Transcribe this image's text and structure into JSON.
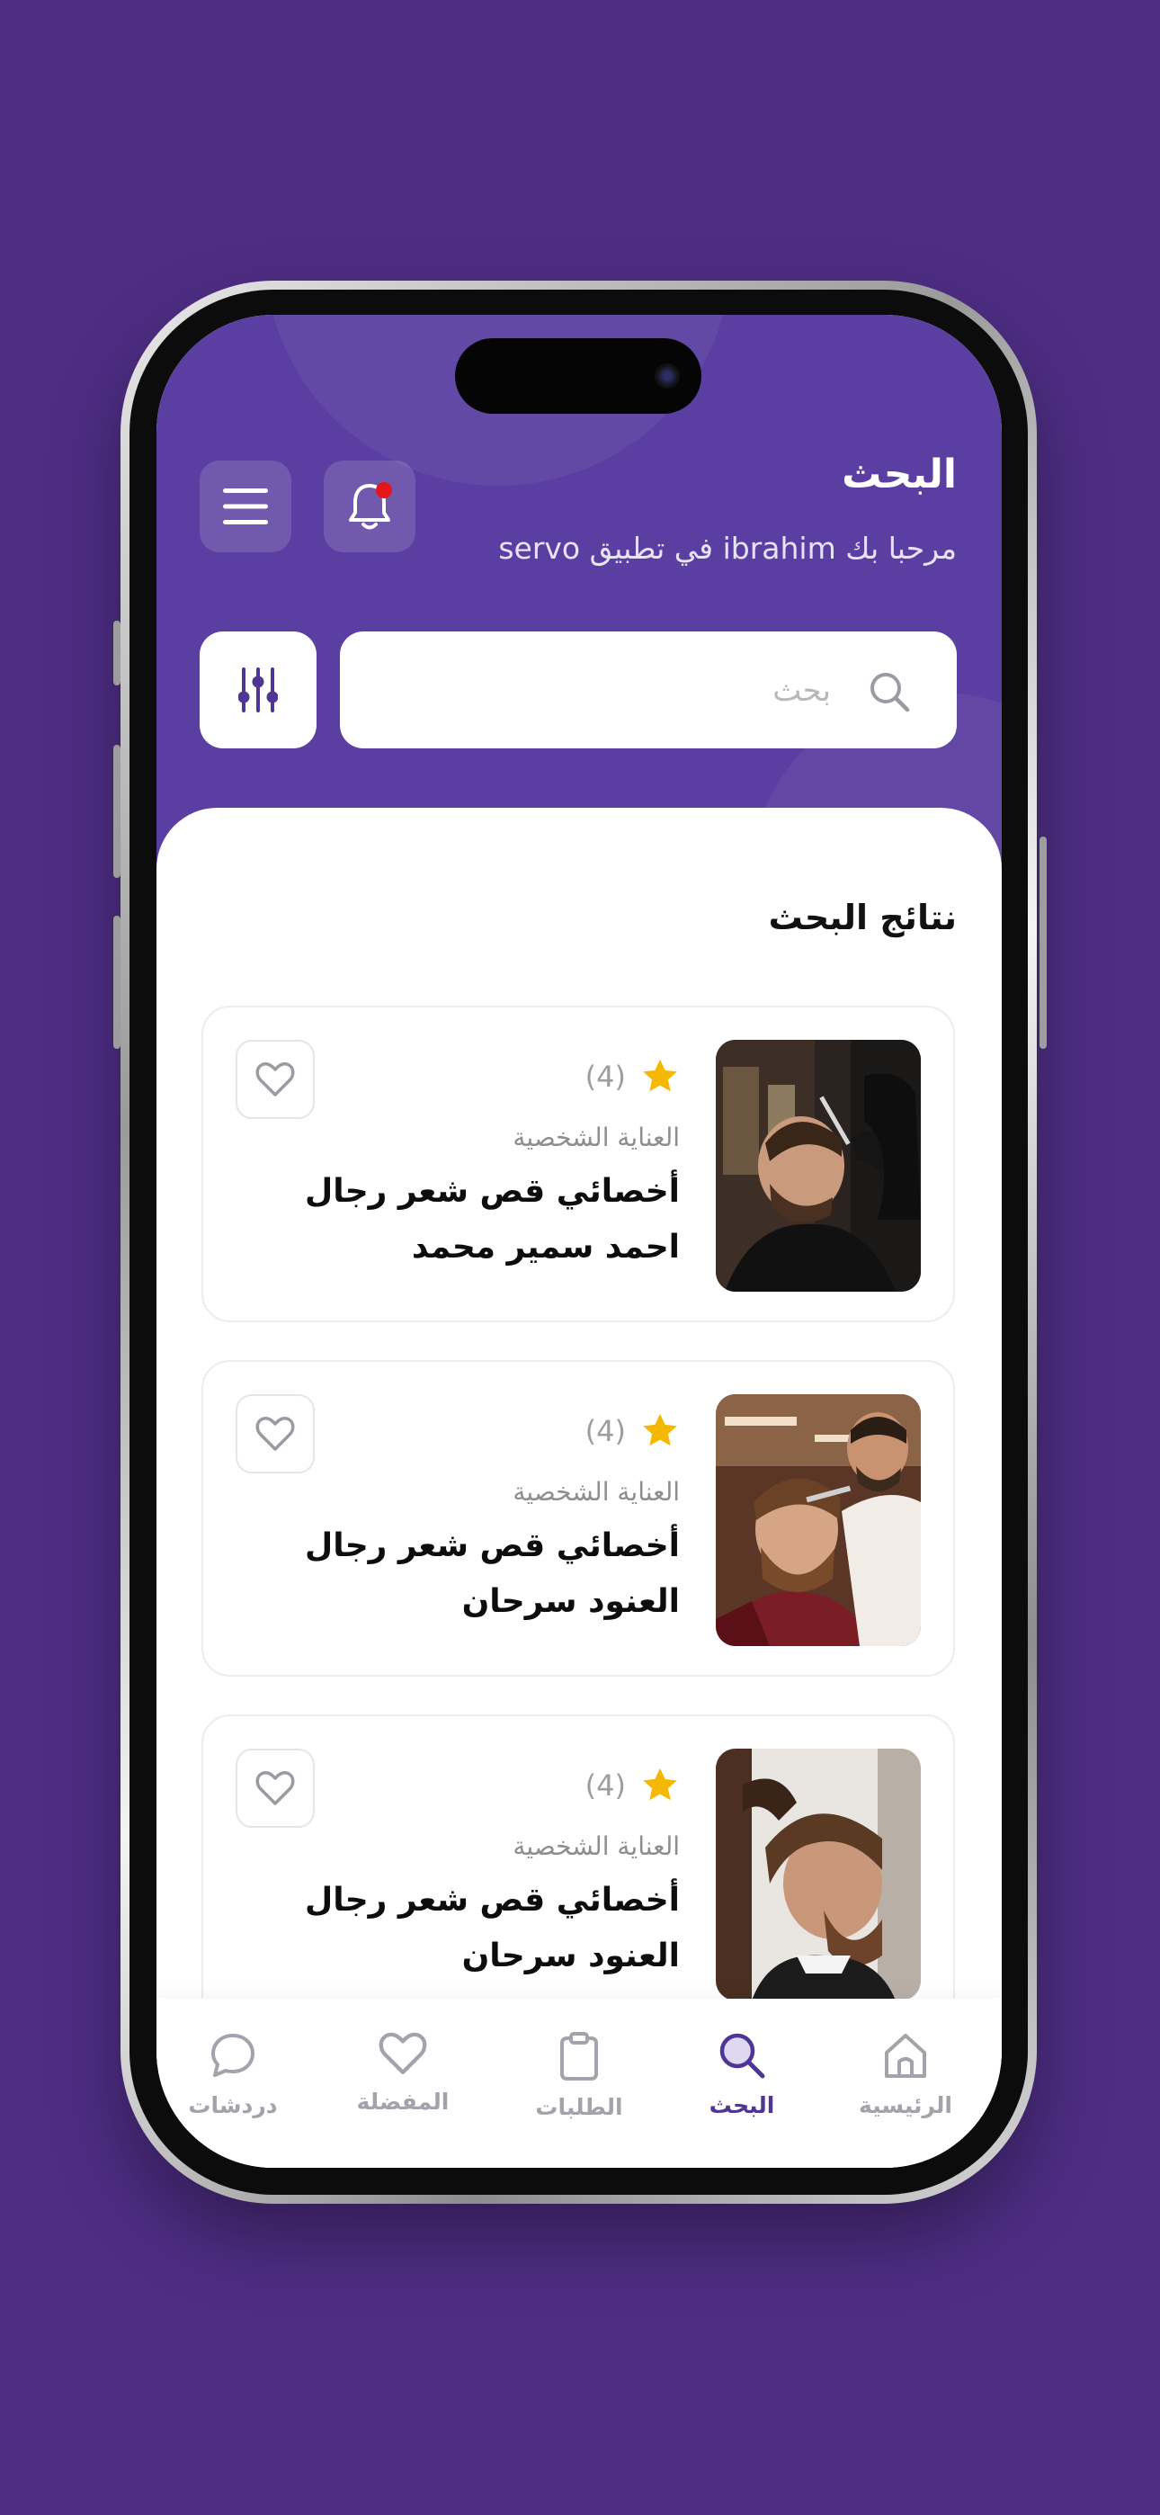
{
  "colors": {
    "background": "#4e2d84",
    "header": "#5a3ea1",
    "accent": "#4f3594",
    "star": "#f5b800",
    "notification_dot": "#e4161b"
  },
  "header": {
    "title": "البحث",
    "subtitle": "مرحبا بك ibrahim في تطبيق servo",
    "menu_icon": "menu-icon",
    "notification_icon": "bell-icon",
    "has_notification": true
  },
  "search": {
    "placeholder": "بحث",
    "icon": "search-icon",
    "filter_icon": "sliders-icon"
  },
  "results": {
    "title": "نتائج البحث",
    "items": [
      {
        "rating_count": "(4)",
        "category": "العناية الشخصية",
        "service": "أخصائي قص شعر رجال",
        "provider": "احمد سمير محمد",
        "favorite": false
      },
      {
        "rating_count": "(4)",
        "category": "العناية الشخصية",
        "service": "أخصائي قص شعر رجال",
        "provider": "العنود سرحان",
        "favorite": false
      },
      {
        "rating_count": "(4)",
        "category": "العناية الشخصية",
        "service": "أخصائي قص شعر رجال",
        "provider": "العنود سرحان",
        "favorite": false
      }
    ]
  },
  "tabbar": {
    "items": [
      {
        "label": "الرئيسية",
        "icon": "home-icon",
        "active": false
      },
      {
        "label": "البحث",
        "icon": "search-icon",
        "active": true
      },
      {
        "label": "الطلبات",
        "icon": "clipboard-icon",
        "active": false
      },
      {
        "label": "المفضلة",
        "icon": "heart-icon",
        "active": false
      },
      {
        "label": "دردشات",
        "icon": "chat-icon",
        "active": false
      }
    ]
  }
}
